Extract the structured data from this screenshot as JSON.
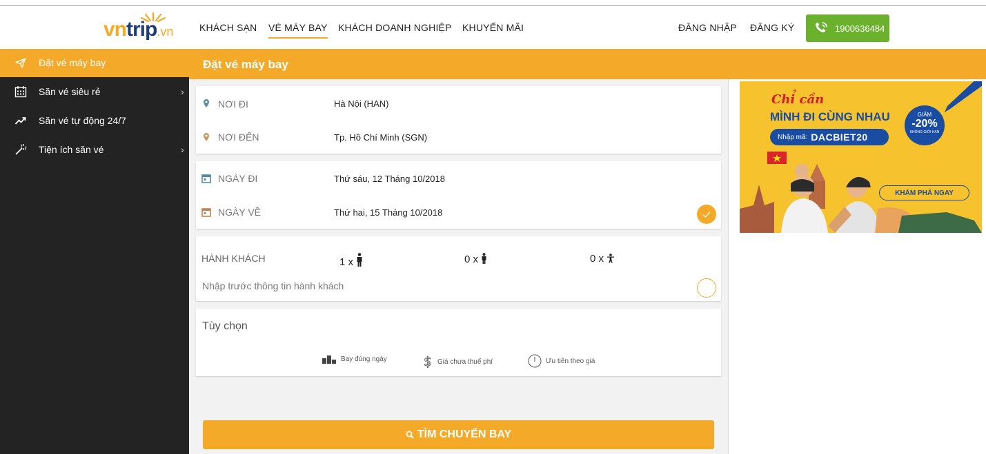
{
  "brand": {
    "logo_vn": "vn",
    "logo_trip": "trip",
    "logo_dot": ".vn",
    "accent": "#f4a928",
    "green": "#6bb12d",
    "navy": "#1f3d7a"
  },
  "nav": {
    "items": [
      "KHÁCH SẠN",
      "VÉ MÁY BAY",
      "KHÁCH DOANH NGHIỆP",
      "KHUYẾN MÃI"
    ],
    "active_index": 1,
    "login": "ĐĂNG NHẬP",
    "register": "ĐĂNG KÝ",
    "hotline": "1900636484"
  },
  "sidebar": {
    "items": [
      {
        "label": "Đặt vé máy bay",
        "icon": "paper-plane-icon",
        "active": true,
        "has_children": false
      },
      {
        "label": "Săn vé siêu rẻ",
        "icon": "calendar-icon",
        "active": false,
        "has_children": true
      },
      {
        "label": "Săn vé tự động 24/7",
        "icon": "trend-up-icon",
        "active": false,
        "has_children": false
      },
      {
        "label": "Tiện ích săn vé",
        "icon": "magic-wand-icon",
        "active": false,
        "has_children": true
      }
    ]
  },
  "page_title": "Đặt vé máy bay",
  "route": {
    "from_label": "NƠI ĐI",
    "from_value": "Hà Nội (HAN)",
    "to_label": "NƠI ĐẾN",
    "to_value": "Tp. Hồ Chí Minh (SGN)"
  },
  "dates": {
    "depart_label": "NGÀY ĐI",
    "depart_value": "Thứ sáu, 12 Tháng 10/2018",
    "return_label": "NGÀY VỀ",
    "return_value": "Thứ hai, 15 Tháng 10/2018",
    "return_enabled": true
  },
  "passengers": {
    "label": "HÀNH KHÁCH",
    "adult": "1 x",
    "child": "0 x",
    "infant": "0 x",
    "prefill_hint": "Nhập trước thông tin hành khách",
    "prefill_enabled": false
  },
  "options": {
    "title": "Tùy chọn",
    "items": [
      "Bay đúng ngày",
      "Giá chưa thuế phí",
      "Ưu tiên theo giá"
    ]
  },
  "search_button": "TÌM CHUYẾN BAY",
  "banner": {
    "script": "Chỉ cần",
    "headline": "MÌNH ĐI CÙNG NHAU",
    "code_prefix": "Nhập mã:",
    "code": "DACBIET20",
    "discount_top": "GIẢM",
    "discount": "-20%",
    "discount_note": "KHÔNG GIỚI HẠN",
    "cta": "KHÁM PHÁ NGAY"
  }
}
